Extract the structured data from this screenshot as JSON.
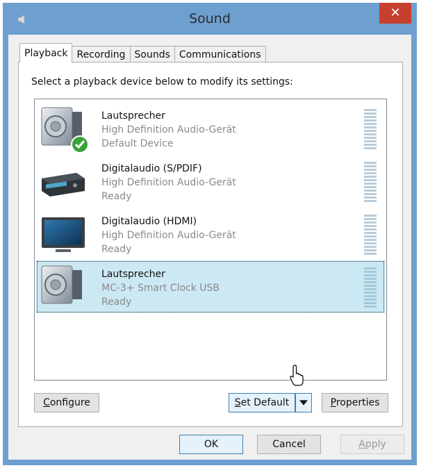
{
  "window": {
    "title": "Sound",
    "close_glyph": "✕"
  },
  "tabs": [
    {
      "label": "Playback",
      "active": true
    },
    {
      "label": "Recording",
      "active": false
    },
    {
      "label": "Sounds",
      "active": false
    },
    {
      "label": "Communications",
      "active": false
    }
  ],
  "instruction": "Select a playback device below to modify its settings:",
  "devices": [
    {
      "name": "Lautsprecher",
      "description": "High Definition Audio-Gerät",
      "status": "Default Device",
      "icon": "speaker-icon",
      "default": true,
      "selected": false
    },
    {
      "name": "Digitalaudio (S/PDIF)",
      "description": "High Definition Audio-Gerät",
      "status": "Ready",
      "icon": "receiver-icon",
      "selected": false
    },
    {
      "name": "Digitalaudio (HDMI)",
      "description": "High Definition Audio-Gerät",
      "status": "Ready",
      "icon": "monitor-icon",
      "selected": false
    },
    {
      "name": "Lautsprecher",
      "description": "MC-3+ Smart Clock USB",
      "status": "Ready",
      "icon": "speaker-icon",
      "selected": true
    }
  ],
  "buttons": {
    "configure": {
      "label": "Configure",
      "access_key": "C"
    },
    "set_default": {
      "label": "Set Default",
      "access_key": "S"
    },
    "properties": {
      "label": "Properties",
      "access_key": "P"
    },
    "ok": "OK",
    "cancel": "Cancel",
    "apply": {
      "label": "Apply",
      "access_key": "A",
      "enabled": false
    }
  },
  "colors": {
    "title_bar": "#6e9fd1",
    "close_button": "#c7402d",
    "selection": "#cce8f3",
    "default_check": "#3aa23a"
  }
}
